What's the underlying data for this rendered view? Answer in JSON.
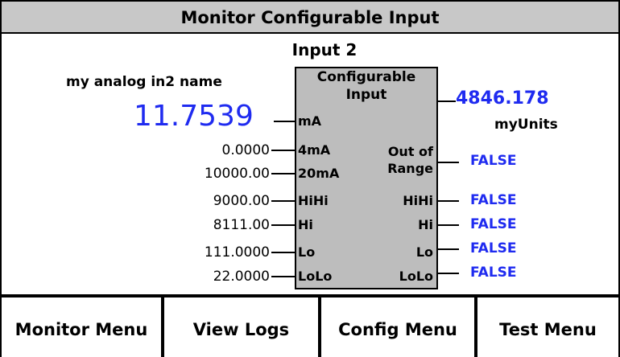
{
  "title": "Monitor Configurable Input",
  "input_label": "Input 2",
  "analog_name": "my analog in2 name",
  "measured_value": "11.7539",
  "block": {
    "title_line1": "Configurable",
    "title_line2": "Input",
    "pin_mA": "mA",
    "pin_4mA": "4mA",
    "pin_20mA": "20mA",
    "pin_hihi": "HiHi",
    "pin_hi": "Hi",
    "pin_lo": "Lo",
    "pin_lolo": "LoLo",
    "out_range_line1": "Out of",
    "out_range_line2": "Range",
    "out_hihi": "HiHi",
    "out_hi": "Hi",
    "out_lo": "Lo",
    "out_lolo": "LoLo"
  },
  "params": {
    "p4mA": "0.0000",
    "p20mA": "10000.00",
    "hihi": "9000.00",
    "hi": "8111.00",
    "lo": "111.0000",
    "lolo": "22.0000"
  },
  "output": {
    "value": "4846.178",
    "units": "myUnits",
    "out_of_range": "FALSE",
    "hihi": "FALSE",
    "hi": "FALSE",
    "lo": "FALSE",
    "lolo": "FALSE"
  },
  "menu": {
    "monitor": "Monitor Menu",
    "logs": "View Logs",
    "config": "Config Menu",
    "test": "Test Menu"
  },
  "colors": {
    "value_blue": "#1f2bf0",
    "title_bg": "#c8c8c8",
    "block_bg": "#bdbdbd"
  }
}
